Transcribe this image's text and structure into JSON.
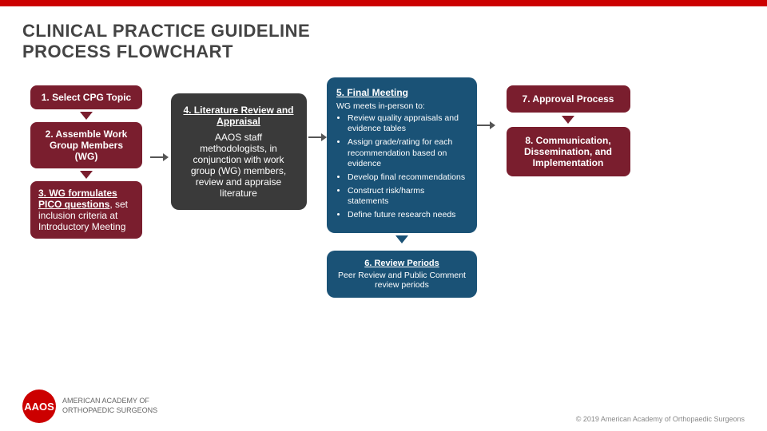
{
  "topbar": {},
  "header": {
    "title_line1": "CLINICAL PRACTICE GUIDELINE",
    "title_line2": "PROCESS FLOWCHART"
  },
  "steps": {
    "step1": {
      "label": "1. Select CPG Topic"
    },
    "step2": {
      "label": "2. Assemble Work Group Members (WG)"
    },
    "step3": {
      "underline_text": "3. WG formulates PICO questions",
      "rest_text": ", set inclusion criteria at Introductory Meeting"
    },
    "step4": {
      "title": "4. Literature Review and Appraisal",
      "body": "AAOS staff methodologists, in conjunction with work group (WG) members, review and appraise literature"
    },
    "step5": {
      "title": "5. Final Meeting",
      "intro": "WG meets in-person to:",
      "bullets": [
        "Review quality appraisals and evidence tables",
        "Assign grade/rating for each recommendation based on evidence",
        "Develop final recommendations",
        "Construct risk/harms statements",
        "Define future research needs"
      ]
    },
    "step6": {
      "title": "6. Review Periods",
      "body": "Peer Review and Public Comment review periods"
    },
    "step7": {
      "label": "7. Approval Process"
    },
    "step8": {
      "label": "8. Communication, Dissemination, and Implementation"
    }
  },
  "footer": {
    "logo_text": "AAOS",
    "org_name": "AMERICAN ACADEMY OF\nORTHOPAEDIC SURGEONS",
    "copyright": "© 2019 American Academy of Orthopaedic Surgeons"
  }
}
